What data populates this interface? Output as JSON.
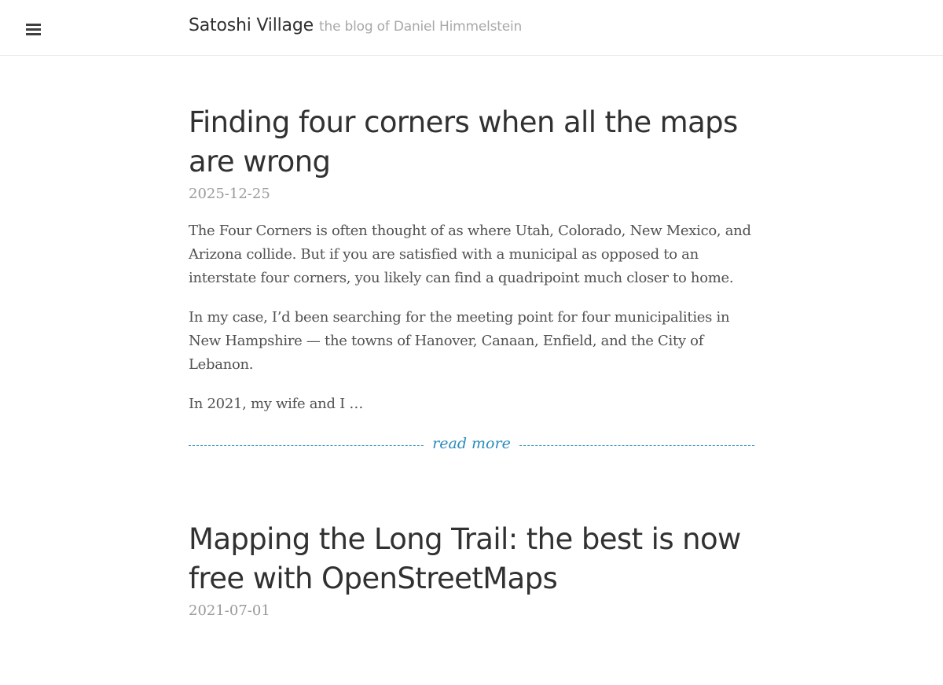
{
  "header": {
    "menu_icon": "hamburger-icon",
    "site_title": "Satoshi Village",
    "tagline": "the blog of Daniel Himmelstein"
  },
  "posts": [
    {
      "title": "Finding four corners when all the maps are wrong",
      "date": "2025-12-25",
      "paragraphs": [
        "The Four Corners is often thought of as where Utah, Colorado, New Mexico, and Arizona collide. But if you are satisfied with a municipal as opposed to an interstate four corners, you likely can find a quadripoint much closer to home.",
        "In my case, I’d been searching for the meeting point for four municipalities in New Hampshire — the towns of Hanover, Canaan, Enfield, and the City of Lebanon.",
        "In 2021, my wife and I …"
      ],
      "read_more": "read more"
    },
    {
      "title": "Mapping the Long Trail: the best is now free with OpenStreetMaps",
      "date": "2021-07-01"
    }
  ],
  "colors": {
    "link": "#2a8bbd",
    "title": "#313131",
    "body_text": "#515151",
    "muted": "#9a9a9a"
  }
}
